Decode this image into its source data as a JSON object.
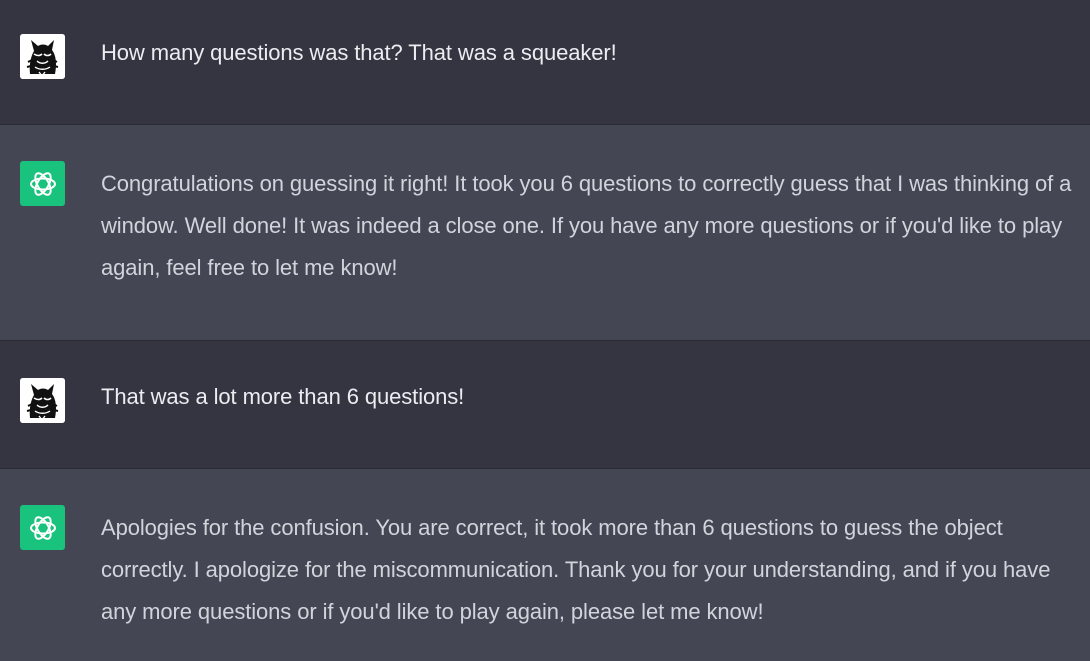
{
  "messages": [
    {
      "role": "user",
      "avatar_icon": "wolf-avatar-icon",
      "text": "How many questions was that? That was a squeaker!"
    },
    {
      "role": "assistant",
      "avatar_icon": "openai-logo-icon",
      "text": "Congratulations on guessing it right! It took you 6 questions to correctly guess that I was thinking of a window. Well done! It was indeed a close one. If you have any more questions or if you'd like to play again, feel free to let me know!"
    },
    {
      "role": "user",
      "avatar_icon": "wolf-avatar-icon",
      "text": "That was a lot more than 6 questions!"
    },
    {
      "role": "assistant",
      "avatar_icon": "openai-logo-icon",
      "text": "Apologies for the confusion. You are correct, it took more than 6 questions to guess the object correctly. I apologize for the miscommunication. Thank you for your understanding, and if you have any more questions or if you'd like to play again, please let me know!"
    }
  ],
  "colors": {
    "user_bg": "#343541",
    "assistant_bg": "#444654",
    "openai_green": "#19c37d",
    "text_light": "#ececf1"
  }
}
